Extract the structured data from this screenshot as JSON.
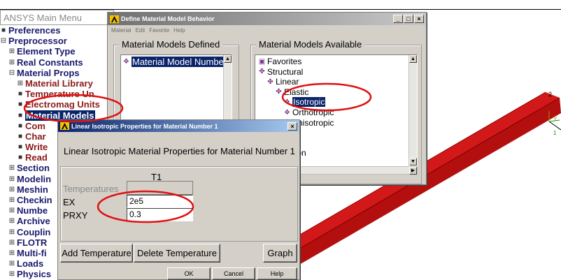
{
  "main_menu": {
    "title": "ANSYS Main Menu",
    "items": [
      {
        "label": "Preferences",
        "glyph": "■",
        "indent": 0,
        "color": "navy"
      },
      {
        "label": "Preprocessor",
        "glyph": "⊟",
        "indent": 0,
        "color": "navy"
      },
      {
        "label": "Element Type",
        "glyph": "⊞",
        "indent": 1,
        "color": "navy"
      },
      {
        "label": "Real Constants",
        "glyph": "⊞",
        "indent": 1,
        "color": "navy"
      },
      {
        "label": "Material Props",
        "glyph": "⊟",
        "indent": 1,
        "color": "navy"
      },
      {
        "label": "Material Library",
        "glyph": "⊞",
        "indent": 2,
        "color": "maroon"
      },
      {
        "label": "Temperature Un",
        "glyph": "■",
        "indent": 2,
        "color": "maroon"
      },
      {
        "label": "Electromag Units",
        "glyph": "■",
        "indent": 2,
        "color": "maroon"
      },
      {
        "label": "Material Models",
        "glyph": "■",
        "indent": 2,
        "color": "black",
        "selected": true
      },
      {
        "label": "Com",
        "glyph": "■",
        "indent": 2,
        "color": "maroon"
      },
      {
        "label": "Char",
        "glyph": "■",
        "indent": 2,
        "color": "maroon"
      },
      {
        "label": "Write",
        "glyph": "■",
        "indent": 2,
        "color": "maroon"
      },
      {
        "label": "Read",
        "glyph": "■",
        "indent": 2,
        "color": "maroon"
      },
      {
        "label": "Section",
        "glyph": "⊞",
        "indent": 1,
        "color": "navy"
      },
      {
        "label": "Modelin",
        "glyph": "⊞",
        "indent": 1,
        "color": "navy"
      },
      {
        "label": "Meshin",
        "glyph": "⊞",
        "indent": 1,
        "color": "navy"
      },
      {
        "label": "Checkin",
        "glyph": "⊞",
        "indent": 1,
        "color": "navy"
      },
      {
        "label": "Numbe",
        "glyph": "⊞",
        "indent": 1,
        "color": "navy"
      },
      {
        "label": "Archive",
        "glyph": "⊞",
        "indent": 1,
        "color": "navy"
      },
      {
        "label": "Couplin",
        "glyph": "⊞",
        "indent": 1,
        "color": "navy"
      },
      {
        "label": "FLOTR",
        "glyph": "⊞",
        "indent": 1,
        "color": "navy"
      },
      {
        "label": "Multi-fi",
        "glyph": "⊞",
        "indent": 1,
        "color": "navy"
      },
      {
        "label": "Loads",
        "glyph": "⊞",
        "indent": 1,
        "color": "navy"
      },
      {
        "label": "Physics",
        "glyph": "⊞",
        "indent": 1,
        "color": "navy"
      }
    ]
  },
  "define_window": {
    "title": "Define Material Model Behavior",
    "menu": [
      "Material",
      "Edit",
      "Favorite",
      "Help"
    ],
    "defined_group_label": "Material Models Defined",
    "defined_item": "Material Model Number",
    "available_group_label": "Material Models Available",
    "available_items": [
      {
        "label": "Favorites",
        "indent": 0,
        "icon": "folder-icon"
      },
      {
        "label": "Structural",
        "indent": 0,
        "icon": "structural-icon"
      },
      {
        "label": "Linear",
        "indent": 1,
        "icon": "structural-icon"
      },
      {
        "label": "Elastic",
        "indent": 2,
        "icon": "structural-icon"
      },
      {
        "label": "Isotropic",
        "indent": 3,
        "icon": "material-icon",
        "selected": true
      },
      {
        "label": "Orthotropic",
        "indent": 3,
        "icon": "material-icon"
      },
      {
        "label": "Anisotropic",
        "indent": 3,
        "icon": "material-icon"
      },
      {
        "label": "ear",
        "indent": 1,
        "icon": ""
      },
      {
        "label": "ty",
        "indent": 1,
        "icon": ""
      },
      {
        "label": "al Expansion",
        "indent": 0,
        "icon": ""
      }
    ]
  },
  "iso_dialog": {
    "title": "Linear Isotropic Properties for Material Number 1",
    "heading": "Linear Isotropic Material Properties for Material Number 1",
    "column_header": "T1",
    "temperatures_label": "Temperatures",
    "rows": [
      {
        "label": "EX",
        "value": "2e5"
      },
      {
        "label": "PRXY",
        "value": "0.3"
      }
    ],
    "add_temperature": "Add Temperature",
    "delete_temperature": "Delete Temperature",
    "graph": "Graph",
    "ok": "OK",
    "cancel": "Cancel",
    "help": "Help"
  },
  "viewport": {
    "axis_label_top": "2",
    "axis_x_label": "X",
    "axis_y_label": "Y",
    "axis_1_label": "1",
    "beam_color": "#e01010"
  },
  "colors": {
    "annotation_red": "#e01010",
    "selection": "#0a246a"
  }
}
